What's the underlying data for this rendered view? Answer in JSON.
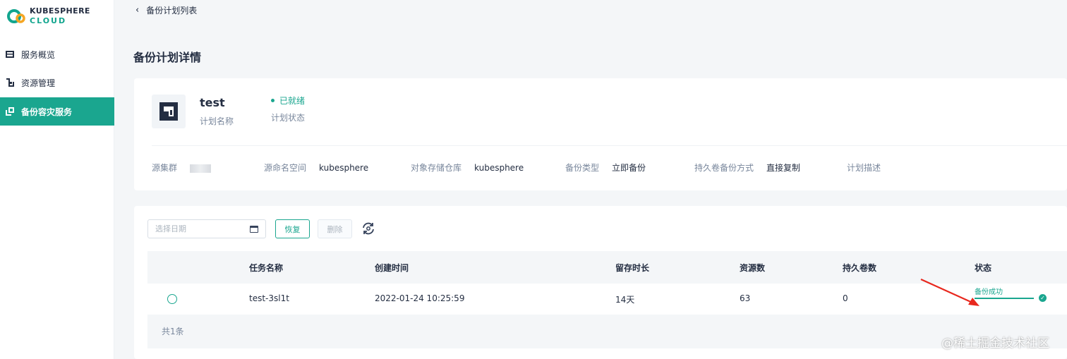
{
  "logo": {
    "line1": "KUBESPHERE",
    "line2": "CLOUD",
    "icon": "kubesphere-cloud-logo"
  },
  "sidebar": {
    "items": [
      {
        "label": "服务概览",
        "icon": "overview-icon",
        "active": false
      },
      {
        "label": "资源管理",
        "icon": "resource-icon",
        "active": false
      },
      {
        "label": "备份容灾服务",
        "icon": "backup-icon",
        "active": true
      }
    ]
  },
  "breadcrumb": {
    "back_label": "备份计划列表",
    "icon": "chevron-left-icon"
  },
  "page": {
    "title": "备份计划详情"
  },
  "plan": {
    "name": "test",
    "name_label": "计划名称",
    "status": "已就绪",
    "status_label": "计划状态",
    "icon": "plan-icon"
  },
  "meta": {
    "source_cluster_label": "源集群",
    "source_namespace_label": "源命名空间",
    "source_namespace_value": "kubesphere",
    "storage_label": "对象存储仓库",
    "storage_value": "kubesphere",
    "backup_type_label": "备份类型",
    "backup_type_value": "立即备份",
    "volume_mode_label": "持久卷备份方式",
    "volume_mode_value": "直接复制",
    "description_label": "计划描述"
  },
  "toolbar": {
    "date_placeholder": "选择日期",
    "restore_label": "恢复",
    "delete_label": "删除",
    "refresh_icon": "refresh-icon",
    "calendar_icon": "calendar-icon"
  },
  "table": {
    "headers": [
      "任务名称",
      "创建时间",
      "留存时长",
      "资源数",
      "持久卷数",
      "状态"
    ],
    "rows": [
      {
        "name": "test-3sl1t",
        "created": "2022-01-24 10:25:59",
        "retention": "14天",
        "resources": "63",
        "volumes": "0",
        "status": "备份成功",
        "status_progress": 1.0
      }
    ],
    "total": "共1条"
  },
  "colors": {
    "accent": "#1aa68f",
    "text": "#242e42",
    "muted": "#79879c",
    "annotation_arrow": "#e8281e"
  },
  "watermark": "@稀土掘金技术社区"
}
